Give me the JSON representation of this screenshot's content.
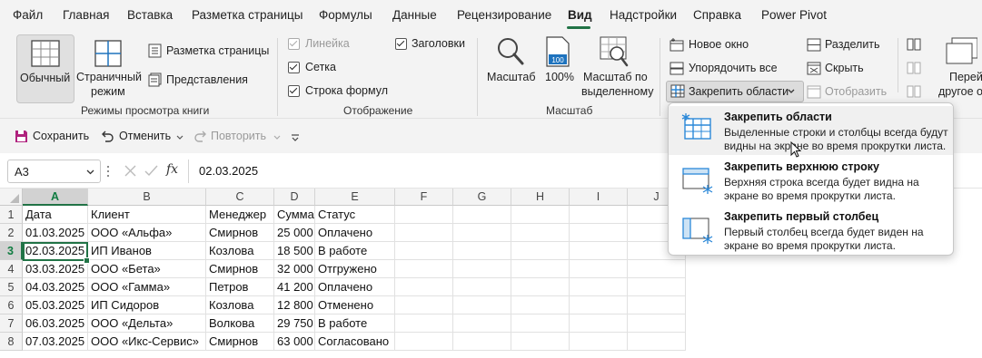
{
  "menu": {
    "tabs": [
      "Файл",
      "Главная",
      "Вставка",
      "Разметка страницы",
      "Формулы",
      "Данные",
      "Рецензирование",
      "Вид",
      "Надстройки",
      "Справка",
      "Power Pivot"
    ],
    "active": "Вид"
  },
  "ribbon": {
    "views": {
      "normal": "Обычный",
      "page_mode_l1": "Страничный",
      "page_mode_l2": "режим",
      "page_layout": "Разметка страницы",
      "custom_views": "Представления",
      "group_label": "Режимы просмотра книги"
    },
    "show": {
      "ruler": "Линейка",
      "gridlines": "Сетка",
      "formula_bar": "Строка формул",
      "headings": "Заголовки",
      "group_label": "Отображение"
    },
    "zoom": {
      "zoom": "Масштаб",
      "zoom100": "100%",
      "zoom_sel_l1": "Масштаб по",
      "zoom_sel_l2": "выделенному",
      "icon_100": "100",
      "group_label": "Масштаб"
    },
    "window": {
      "new_window": "Новое окно",
      "arrange_all": "Упорядочить все",
      "freeze_panes": "Закрепить области",
      "split": "Разделить",
      "hide": "Скрыть",
      "unhide": "Отобразить",
      "switch_l1": "Перей",
      "switch_l2": "другое о"
    }
  },
  "qat": {
    "save": "Сохранить",
    "undo": "Отменить",
    "redo": "Повторить"
  },
  "formula_bar": {
    "name_box": "A3",
    "fx": "fx",
    "value": "02.03.2025"
  },
  "grid": {
    "columns": [
      "A",
      "B",
      "C",
      "D",
      "E",
      "F",
      "G",
      "H",
      "I",
      "J"
    ],
    "selected_column": "A",
    "selected_row": "3",
    "rows": [
      {
        "n": "1",
        "cells": [
          "Дата",
          "Клиент",
          "Менеджер",
          "Сумма",
          "Статус"
        ]
      },
      {
        "n": "2",
        "cells": [
          "01.03.2025",
          "ООО «Альфа»",
          "Смирнов",
          "25 000",
          "Оплачено"
        ]
      },
      {
        "n": "3",
        "cells": [
          "02.03.2025",
          "ИП Иванов",
          "Козлова",
          "18 500",
          "В работе"
        ]
      },
      {
        "n": "4",
        "cells": [
          "03.03.2025",
          "ООО «Бета»",
          "Смирнов",
          "32 000",
          "Отгружено"
        ]
      },
      {
        "n": "5",
        "cells": [
          "04.03.2025",
          "ООО «Гамма»",
          "Петров",
          "41 200",
          "Оплачено"
        ]
      },
      {
        "n": "6",
        "cells": [
          "05.03.2025",
          "ИП Сидоров",
          "Козлова",
          "12 800",
          "Отменено"
        ]
      },
      {
        "n": "7",
        "cells": [
          "06.03.2025",
          "ООО «Дельта»",
          "Волкова",
          "29 750",
          "В работе"
        ]
      },
      {
        "n": "8",
        "cells": [
          "07.03.2025",
          "ООО «Икс-Сервис»",
          "Смирнов",
          "63 000",
          "Согласовано"
        ]
      }
    ]
  },
  "freeze_menu": {
    "items": [
      {
        "title": "Закрепить области",
        "desc": "Выделенные строки и столбцы всегда будут видны на экране во время прокрутки листа."
      },
      {
        "title": "Закрепить верхнюю строку",
        "desc": "Верхняя строка всегда будет видна на экране во время прокрутки листа."
      },
      {
        "title": "Закрепить первый столбец",
        "desc": "Первый столбец всегда будет виден на экране во время прокрутки листа."
      }
    ]
  },
  "colors": {
    "accent": "#217346",
    "active_green": "#107c41",
    "icon_blue": "#1e73be",
    "freeze_blue": "#2b88d8"
  }
}
